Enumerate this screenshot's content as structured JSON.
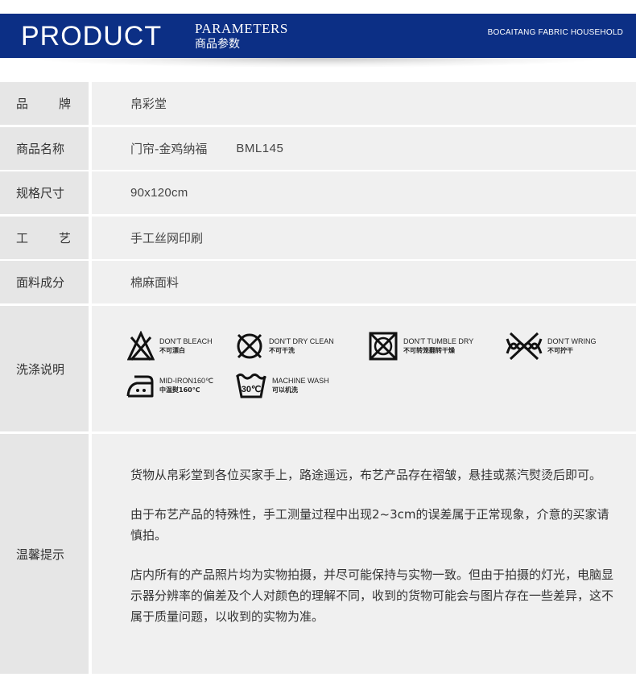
{
  "header": {
    "title": "PRODUCT",
    "subtitle_en": "PARAMETERS",
    "subtitle_cn": "商品参数",
    "brand_tag": "BOCAITANG FABRIC HOUSEHOLD",
    "color": "#0c2f85"
  },
  "rows": {
    "brand": {
      "label_chars": [
        "品",
        "牌"
      ],
      "value": "帛彩堂"
    },
    "name": {
      "label": "商品名称",
      "value": "门帘-金鸡纳福",
      "code": "BML145"
    },
    "size": {
      "label": "规格尺寸",
      "value": "90x120cm"
    },
    "craft": {
      "label_chars": [
        "工",
        "艺"
      ],
      "value": "手工丝网印刷"
    },
    "fabric": {
      "label": "面料成分",
      "value": "棉麻面料"
    },
    "wash": {
      "label": "洗涤说明"
    },
    "notes": {
      "label": "温馨提示",
      "paragraphs": [
        "货物从帛彩堂到各位买家手上，路途遥远，布艺产品存在褶皱，悬挂或蒸汽熨烫后即可。",
        "由于布艺产品的特殊性，手工测量过程中出现2~3cm的误差属于正常现象，介意的买家请慎拍。",
        "店内所有的产品照片均为实物拍摄，并尽可能保持与实物一致。但由于拍摄的灯光，电脑显示器分辨率的偏差及个人对颜色的理解不同，收到的货物可能会与图片存在一些差异，这不属于质量问题，以收到的实物为准。"
      ]
    }
  },
  "care": [
    {
      "icon": "no-bleach-icon",
      "en": "DON'T BLEACH",
      "cn": "不可漂白"
    },
    {
      "icon": "no-dry-clean-icon",
      "en": "DON'T DRY CLEAN",
      "cn": "不可干洗"
    },
    {
      "icon": "no-tumble-dry-icon",
      "en": "DON'T TUMBLE DRY",
      "cn": "不可转笼翻转干燥"
    },
    {
      "icon": "no-wring-icon",
      "en": "DON'T WRING",
      "cn": "不可拧干"
    },
    {
      "icon": "iron-icon",
      "en": "MID-IRON160℃",
      "cn": "中温熨160℃"
    },
    {
      "icon": "machine-wash-icon",
      "en": "MACHINE WASH",
      "cn": "可以机洗",
      "temp": "30℃"
    }
  ]
}
